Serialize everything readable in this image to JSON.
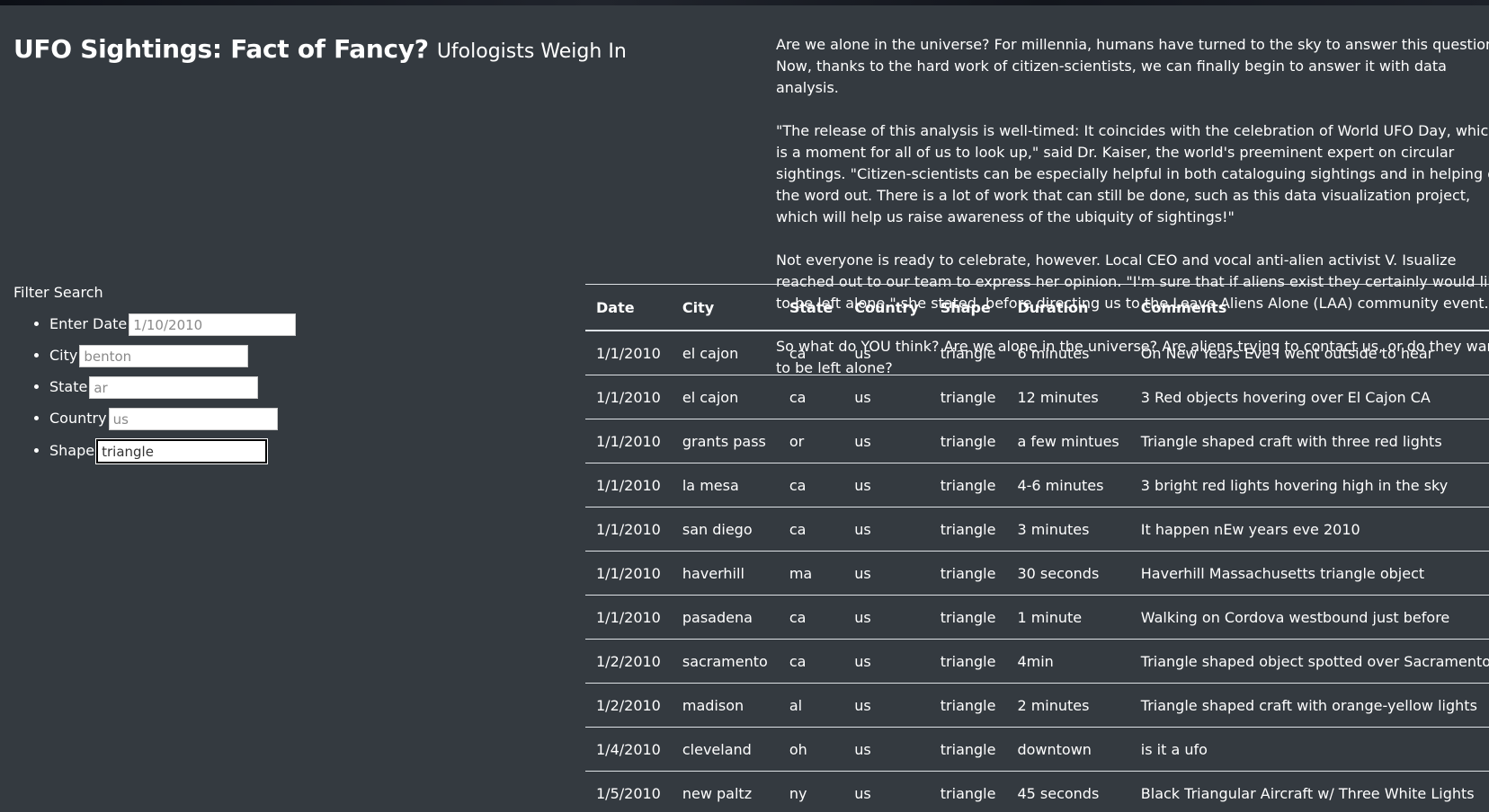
{
  "header": {
    "title": "UFO Sightings: Fact of Fancy?",
    "subtitle": "Ufologists Weigh In"
  },
  "intro": {
    "paragraphs": [
      "Are we alone in the universe? For millennia, humans have turned to the sky to answer this question. Now, thanks to the hard work of citizen-scientists, we can finally begin to answer it with data analysis.",
      "\"The release of this analysis is well-timed: It coincides with the celebration of World UFO Day, which is a moment for all of us to look up,\" said Dr. Kaiser, the world's preeminent expert on circular sightings. \"Citizen-scientists can be especially helpful in both cataloguing sightings and in helping get the word out. There is a lot of work that can still be done, such as this data visualization project, which will help us raise awareness of the ubiquity of sightings!\"",
      "Not everyone is ready to celebrate, however. Local CEO and vocal anti-alien activist V. Isualize reached out to our team to express her opinion. \"I'm sure that if aliens exist they certainly would like to be left alone,\" she stated, before directing us to the Leave Aliens Alone (LAA) community event.",
      "So what do YOU think? Are we alone in the universe? Are aliens trying to contact us, or do they want to be left alone?"
    ]
  },
  "filter": {
    "title": "Filter Search",
    "fields": [
      {
        "label": "Enter Date",
        "value": "",
        "placeholder": "1/10/2010"
      },
      {
        "label": "City",
        "value": "",
        "placeholder": "benton"
      },
      {
        "label": "State",
        "value": "",
        "placeholder": "ar"
      },
      {
        "label": "Country",
        "value": "",
        "placeholder": "us"
      },
      {
        "label": "Shape",
        "value": "triangle",
        "placeholder": ""
      }
    ]
  },
  "table": {
    "headers": [
      "Date",
      "City",
      "State",
      "Country",
      "Shape",
      "Duration",
      "Comments"
    ],
    "rows": [
      [
        "1/1/2010",
        "el cajon",
        "ca",
        "us",
        "triangle",
        "6 minutes",
        "On New Years Eve I went outside to hear"
      ],
      [
        "1/1/2010",
        "el cajon",
        "ca",
        "us",
        "triangle",
        "12 minutes",
        "3 Red objects hovering over El Cajon CA"
      ],
      [
        "1/1/2010",
        "grants pass",
        "or",
        "us",
        "triangle",
        "a few mintues",
        "Triangle shaped craft with three red lights"
      ],
      [
        "1/1/2010",
        "la mesa",
        "ca",
        "us",
        "triangle",
        "4-6 minutes",
        "3 bright red lights hovering high in the sky"
      ],
      [
        "1/1/2010",
        "san diego",
        "ca",
        "us",
        "triangle",
        "3 minutes",
        "It happen nEw years eve 2010"
      ],
      [
        "1/1/2010",
        "haverhill",
        "ma",
        "us",
        "triangle",
        "30 seconds",
        "Haverhill Massachusetts triangle object"
      ],
      [
        "1/1/2010",
        "pasadena",
        "ca",
        "us",
        "triangle",
        "1 minute",
        "Walking on Cordova westbound just before"
      ],
      [
        "1/2/2010",
        "sacramento",
        "ca",
        "us",
        "triangle",
        "4min",
        "Triangle shaped object spotted over Sacramento"
      ],
      [
        "1/2/2010",
        "madison",
        "al",
        "us",
        "triangle",
        "2 minutes",
        "Triangle shaped craft with orange-yellow lights"
      ],
      [
        "1/4/2010",
        "cleveland",
        "oh",
        "us",
        "triangle",
        "downtown",
        "is it a ufo"
      ],
      [
        "1/5/2010",
        "new paltz",
        "ny",
        "us",
        "triangle",
        "45 seconds",
        "Black Triangular Aircraft w/ Three White Lights"
      ]
    ]
  }
}
